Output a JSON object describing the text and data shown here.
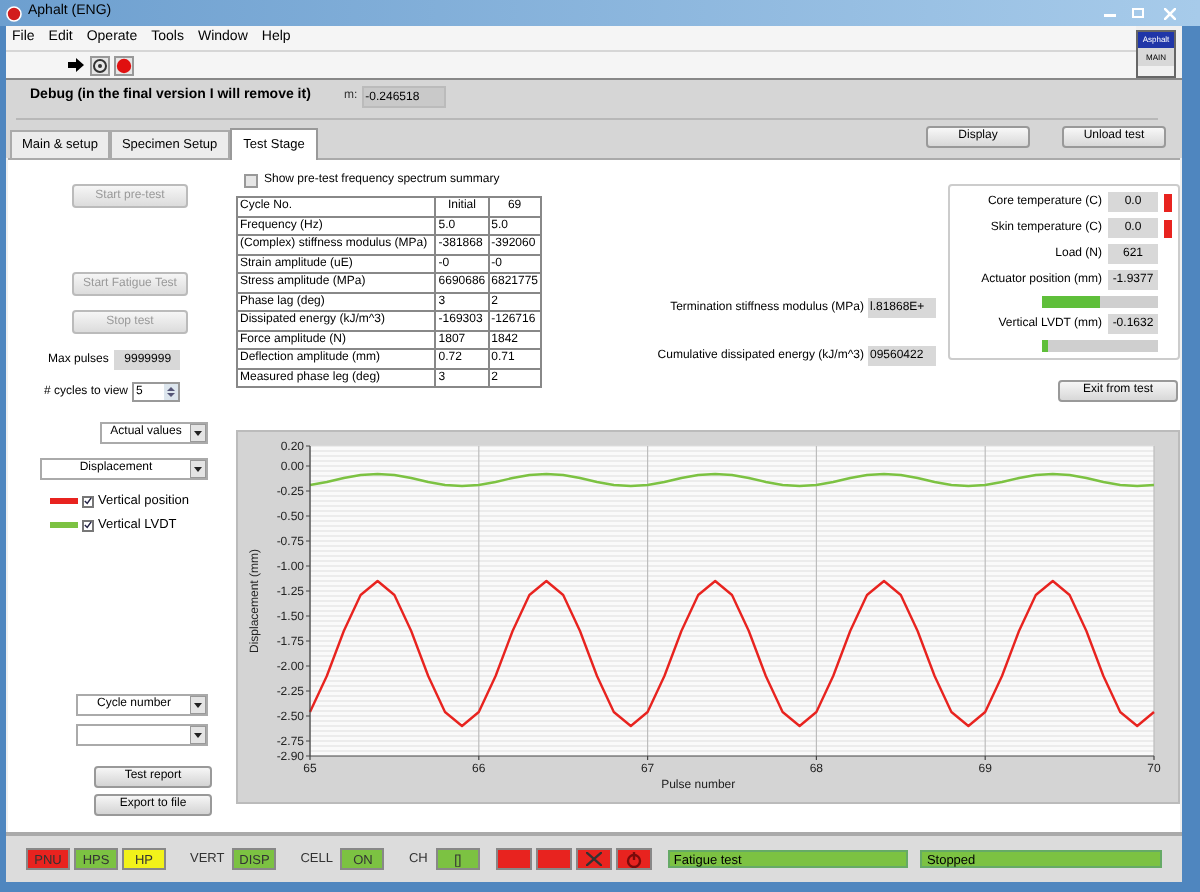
{
  "window": {
    "title": "Aphalt (ENG)"
  },
  "menu": [
    "File",
    "Edit",
    "Operate",
    "Tools",
    "Window",
    "Help"
  ],
  "logo": {
    "line_1": "Asphalt",
    "line_2": "MAIN"
  },
  "debug": {
    "label": "Debug (in the final version I will remove it)",
    "field_label": "m:",
    "value": "-0.246518"
  },
  "tabs": [
    {
      "label": "Main & setup",
      "selected": false
    },
    {
      "label": "Specimen Setup",
      "selected": false
    },
    {
      "label": "Test Stage",
      "selected": true
    }
  ],
  "header_buttons": [
    "Display",
    "Unload test"
  ],
  "start_pre_test": {
    "label": "Start pre-test",
    "disabled": true
  },
  "test_buttons": [
    {
      "label": "Start Fatigue Test",
      "disabled": true
    },
    {
      "label": "Stop test",
      "disabled": true
    }
  ],
  "max_pulses": {
    "label": "Max pulses",
    "value": "9999999"
  },
  "cycles_to_view": {
    "label": "# cycles to view",
    "value": "5"
  },
  "value_mode": {
    "value": "Actual values"
  },
  "quantity": {
    "value": "Displacement"
  },
  "legend": [
    {
      "checked": true
    },
    {
      "checked": true
    }
  ],
  "x_axis_selector": {
    "value": "Cycle number"
  },
  "report_buttons": [
    "Test report",
    "Export to file"
  ],
  "spectrum_checkbox": {
    "label": "Show pre-test frequency spectrum summary",
    "checked": false
  },
  "results_table": {
    "columns": [
      "Cycle No.",
      "Initial",
      "69"
    ],
    "rows": [
      [
        "Frequency (Hz)",
        "5.0",
        "5.0"
      ],
      [
        "(Complex) stiffness modulus (MPa)",
        "-381868",
        "-392060"
      ],
      [
        "Strain amplitude (uE)",
        "-0",
        "-0"
      ],
      [
        "Stress amplitude (MPa)",
        "6690686",
        "6821775"
      ],
      [
        "Phase lag (deg)",
        "3",
        "2"
      ],
      [
        "Dissipated energy (kJ/m^3)",
        "-169303",
        "-126716"
      ],
      [
        "Force amplitude (N)",
        "1807",
        "1842"
      ],
      [
        "Deflection amplitude (mm)",
        "0.72",
        "0.71"
      ],
      [
        "Measured phase leg (deg)",
        "3",
        "2"
      ]
    ]
  },
  "summary_fields": [
    {
      "label": "Termination stiffness modulus (MPa)",
      "value": "l.81868E+"
    },
    {
      "label": "Cumulative dissipated energy (kJ/m^3)",
      "value": "09560422"
    }
  ],
  "sensors": [
    {
      "kind": "reading",
      "label": "Core temperature (C)",
      "value": "0.0",
      "alarm": true
    },
    {
      "kind": "reading",
      "label": "Skin temperature (C)",
      "value": "0.0",
      "alarm": true
    },
    {
      "kind": "reading",
      "label": "Load (N)",
      "value": "621",
      "alarm": false
    },
    {
      "kind": "reading",
      "label": "Actuator position (mm)",
      "value": "-1.9377",
      "alarm": false
    },
    {
      "kind": "bar",
      "level": 0.5
    },
    {
      "kind": "reading",
      "label": "Vertical LVDT (mm)",
      "value": "-0.1632",
      "alarm": false
    },
    {
      "kind": "bar",
      "level": 0.05
    }
  ],
  "exit_button": "Exit from test",
  "chart_data": {
    "type": "line",
    "xlabel": "Pulse number",
    "ylabel": "Displacement (mm)",
    "x": [
      65,
      65.1,
      65.2,
      65.3,
      65.4,
      65.5,
      65.6,
      65.7,
      65.8,
      65.9,
      66,
      66.1,
      66.2,
      66.3,
      66.4,
      66.5,
      66.6,
      66.7,
      66.8,
      66.9,
      67,
      67.1,
      67.2,
      67.3,
      67.4,
      67.5,
      67.6,
      67.7,
      67.8,
      67.9,
      68,
      68.1,
      68.2,
      68.3,
      68.4,
      68.5,
      68.6,
      68.7,
      68.8,
      68.9,
      69,
      69.1,
      69.2,
      69.3,
      69.4,
      69.5,
      69.6,
      69.7,
      69.8,
      69.9,
      70
    ],
    "series": [
      {
        "name": "Vertical position",
        "color": "#e8231f",
        "values": [
          -2.46,
          -2.1,
          -1.65,
          -1.29,
          -1.15,
          -1.29,
          -1.65,
          -2.1,
          -2.46,
          -2.6,
          -2.46,
          -2.1,
          -1.65,
          -1.29,
          -1.15,
          -1.29,
          -1.65,
          -2.1,
          -2.46,
          -2.6,
          -2.46,
          -2.1,
          -1.65,
          -1.29,
          -1.15,
          -1.29,
          -1.65,
          -2.1,
          -2.46,
          -2.6,
          -2.46,
          -2.1,
          -1.65,
          -1.29,
          -1.15,
          -1.29,
          -1.65,
          -2.1,
          -2.46,
          -2.6,
          -2.46,
          -2.1,
          -1.65,
          -1.29,
          -1.15,
          -1.29,
          -1.65,
          -2.1,
          -2.46,
          -2.6,
          -2.46
        ]
      },
      {
        "name": "Vertical LVDT",
        "color": "#7cc242",
        "values": [
          -0.19,
          -0.16,
          -0.12,
          -0.09,
          -0.08,
          -0.09,
          -0.12,
          -0.16,
          -0.19,
          -0.2,
          -0.19,
          -0.16,
          -0.12,
          -0.09,
          -0.08,
          -0.09,
          -0.12,
          -0.16,
          -0.19,
          -0.2,
          -0.19,
          -0.16,
          -0.12,
          -0.09,
          -0.08,
          -0.09,
          -0.12,
          -0.16,
          -0.19,
          -0.2,
          -0.19,
          -0.16,
          -0.12,
          -0.09,
          -0.08,
          -0.09,
          -0.12,
          -0.16,
          -0.19,
          -0.2,
          -0.19,
          -0.16,
          -0.12,
          -0.09,
          -0.08,
          -0.09,
          -0.12,
          -0.16,
          -0.19,
          -0.2,
          -0.19
        ]
      }
    ],
    "grid": true,
    "xlim": [
      65,
      70
    ],
    "ylim": [
      -2.9,
      0.2
    ],
    "xticks": [
      65,
      66,
      67,
      68,
      69,
      70
    ],
    "yticks": [
      {
        "value": 0.2,
        "label": "0.20"
      },
      {
        "value": 0,
        "label": "0.00"
      },
      {
        "value": -0.25,
        "label": "-0.25"
      },
      {
        "value": -0.5,
        "label": "-0.50"
      },
      {
        "value": -0.75,
        "label": "-0.75"
      },
      {
        "value": -1,
        "label": "-1.00"
      },
      {
        "value": -1.25,
        "label": "-1.25"
      },
      {
        "value": -1.5,
        "label": "-1.50"
      },
      {
        "value": -1.75,
        "label": "-1.75"
      },
      {
        "value": -2,
        "label": "-2.00"
      },
      {
        "value": -2.25,
        "label": "-2.25"
      },
      {
        "value": -2.5,
        "label": "-2.50"
      },
      {
        "value": -2.75,
        "label": "-2.75"
      },
      {
        "value": -2.9,
        "label": "-2.90"
      }
    ]
  },
  "status_bar": [
    {
      "kind": "lamp",
      "text": "PNU",
      "color": "#e8231f"
    },
    {
      "kind": "lamp",
      "text": "HPS",
      "color": "#7cc242"
    },
    {
      "kind": "lamp",
      "text": "HP",
      "color": "#f2f21a"
    },
    {
      "kind": "caption",
      "text": "VERT"
    },
    {
      "kind": "lamp",
      "text": "DISP",
      "color": "#7cc242"
    },
    {
      "kind": "caption",
      "text": "CELL"
    },
    {
      "kind": "lamp",
      "text": "ON",
      "color": "#7cc242"
    },
    {
      "kind": "caption",
      "text": "CH"
    },
    {
      "kind": "lamp",
      "text": "[]",
      "color": "#7cc242"
    },
    {
      "kind": "blank",
      "color": "#e8231f"
    },
    {
      "kind": "blank",
      "color": "#e8231f"
    },
    {
      "kind": "cross",
      "color": "#e8231f"
    },
    {
      "kind": "power",
      "color": "#e8231f"
    }
  ],
  "status_fields": [
    "Fatigue test",
    "Stopped"
  ]
}
